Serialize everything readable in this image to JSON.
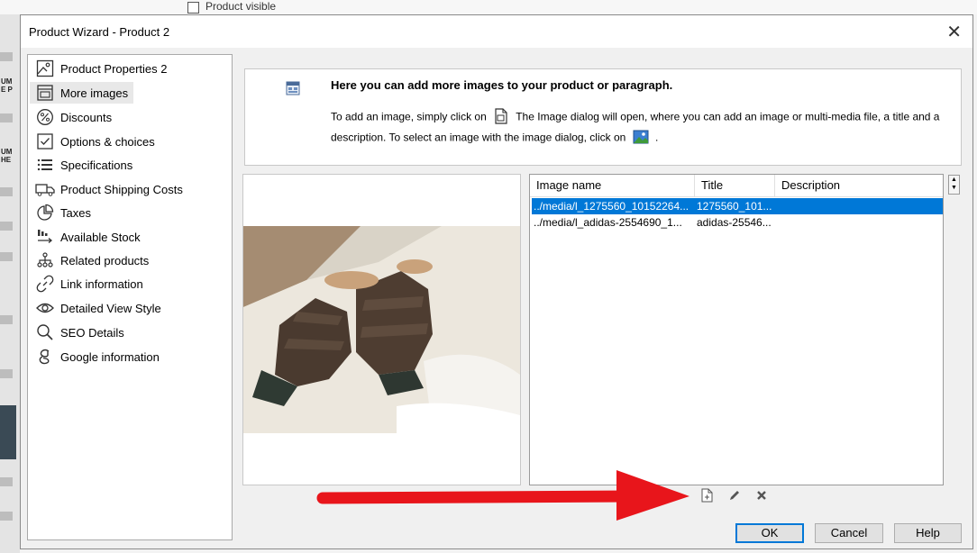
{
  "background": {
    "top_text": "Product visible"
  },
  "dialog": {
    "title": "Product Wizard - Product 2",
    "close_glyph": "✕"
  },
  "nav": {
    "items": [
      {
        "label": "Product Properties 2",
        "icon": "image-frame-icon"
      },
      {
        "label": "More images",
        "icon": "images-icon",
        "selected": true
      },
      {
        "label": "Discounts",
        "icon": "percent-icon"
      },
      {
        "label": "Options & choices",
        "icon": "checkbox-icon"
      },
      {
        "label": "Specifications",
        "icon": "list-icon"
      },
      {
        "label": "Product Shipping Costs",
        "icon": "truck-icon"
      },
      {
        "label": "Taxes",
        "icon": "pie-chart-icon"
      },
      {
        "label": "Available Stock",
        "icon": "stock-icon"
      },
      {
        "label": "Related products",
        "icon": "hierarchy-icon"
      },
      {
        "label": "Link information",
        "icon": "link-icon"
      },
      {
        "label": "Detailed View Style",
        "icon": "eye-icon"
      },
      {
        "label": "SEO Details",
        "icon": "search-icon"
      },
      {
        "label": "Google information",
        "icon": "google-icon"
      }
    ]
  },
  "info": {
    "heading": "Here you can add more images to your product or paragraph.",
    "line1_a": "To add an image, simply click on",
    "line1_b": "The Image dialog will open, where you can add an image or multi-media file, a title and a",
    "line2_a": "description. To select an image with the image dialog, click on",
    "line2_b": "."
  },
  "table": {
    "columns": [
      "Image name",
      "Title",
      "Description"
    ],
    "rows": [
      {
        "name": "../media/l_1275560_10152264...",
        "title": "1275560_101...",
        "description": "",
        "selected": true
      },
      {
        "name": "../media/l_adidas-2554690_1...",
        "title": "adidas-25546...",
        "description": "",
        "selected": false
      }
    ]
  },
  "buttons": {
    "ok": "OK",
    "cancel": "Cancel",
    "help": "Help"
  },
  "colors": {
    "selection": "#0078d7",
    "annotation_arrow": "#e8151b"
  }
}
